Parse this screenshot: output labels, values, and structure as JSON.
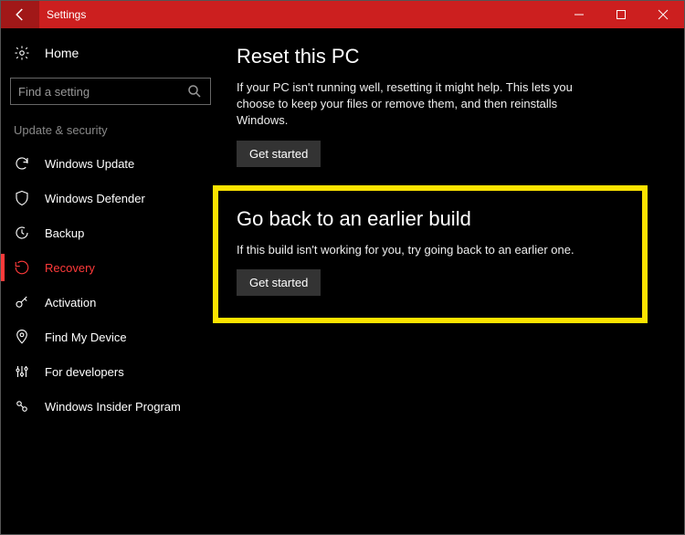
{
  "titlebar": {
    "app_title": "Settings"
  },
  "sidebar": {
    "home_label": "Home",
    "search_placeholder": "Find a setting",
    "group_label": "Update & security",
    "items": [
      {
        "label": "Windows Update"
      },
      {
        "label": "Windows Defender"
      },
      {
        "label": "Backup"
      },
      {
        "label": "Recovery"
      },
      {
        "label": "Activation"
      },
      {
        "label": "Find My Device"
      },
      {
        "label": "For developers"
      },
      {
        "label": "Windows Insider Program"
      }
    ]
  },
  "main": {
    "reset": {
      "title": "Reset this PC",
      "desc": "If your PC isn't running well, resetting it might help. This lets you choose to keep your files or remove them, and then reinstalls Windows.",
      "button": "Get started"
    },
    "goback": {
      "title": "Go back to an earlier build",
      "desc": "If this build isn't working for you, try going back to an earlier one.",
      "button": "Get started"
    }
  }
}
